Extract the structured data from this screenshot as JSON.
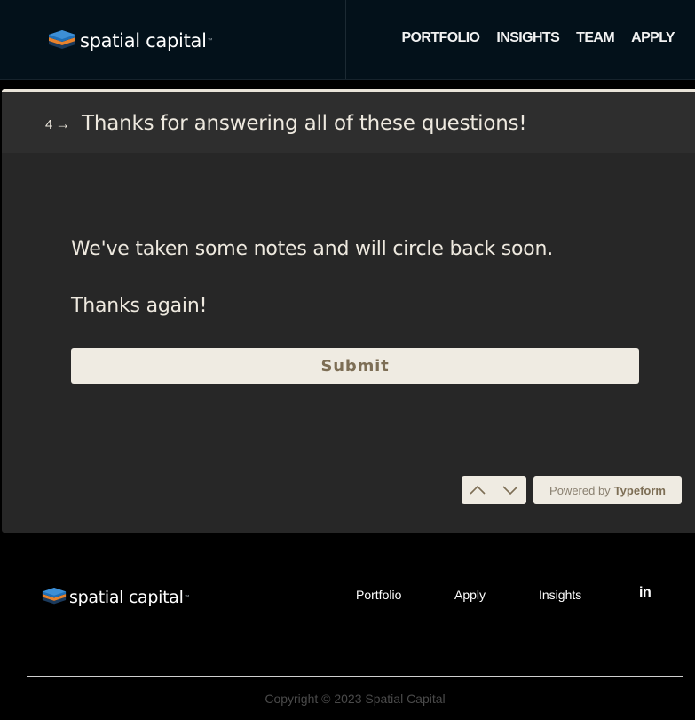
{
  "header": {
    "logo_text": "spatial capital",
    "nav": [
      "PORTFOLIO",
      "INSIGHTS",
      "TEAM",
      "APPLY"
    ]
  },
  "form": {
    "question_number": "4",
    "question_title": "Thanks for answering all of these questions!",
    "message_line1": "We've taken some notes and will circle back soon.",
    "message_line2": "Thanks again!",
    "submit_label": "Submit",
    "powered_by_prefix": "Powered by",
    "powered_by_brand": "Typeform",
    "nav_up_icon": "chevron-up-icon",
    "nav_down_icon": "chevron-down-icon"
  },
  "footer": {
    "logo_text": "spatial capital",
    "links": [
      "Portfolio",
      "Apply",
      "Insights"
    ],
    "social_icon": "linkedin-icon",
    "social_text": "in",
    "copyright": "Copyright © 2023 Spatial Capital"
  },
  "colors": {
    "header_bg": "#03111a",
    "panel_bg": "#272727",
    "accent_cream": "#efebe2",
    "text_cream": "#eee9df",
    "logo_blue": "#1e6fb8",
    "logo_orange": "#e7822d"
  }
}
